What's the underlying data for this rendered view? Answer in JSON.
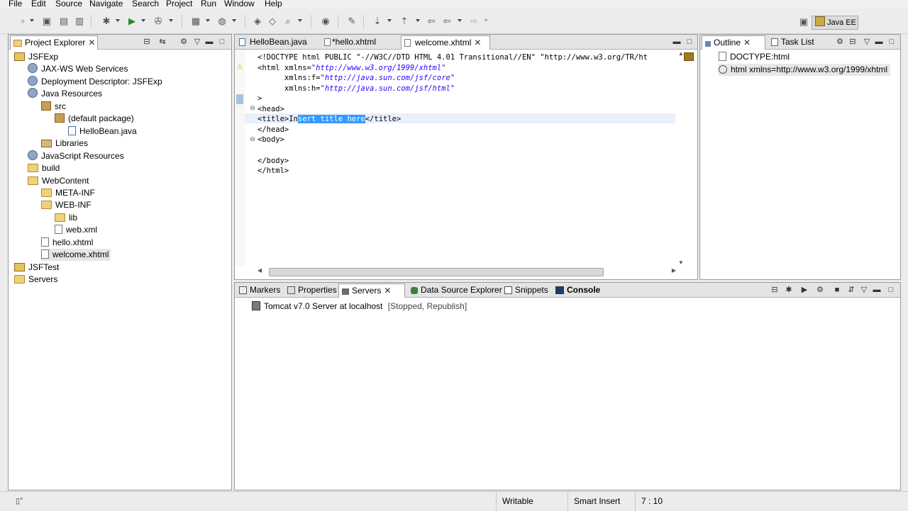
{
  "menu": [
    "File",
    "Edit",
    "Source",
    "Navigate",
    "Search",
    "Project",
    "Run",
    "Window",
    "Help"
  ],
  "perspective": "Java EE",
  "project_explorer": {
    "title": "Project Explorer",
    "items": [
      {
        "label": "JSFExp",
        "depth": 0,
        "icon": "project-icon"
      },
      {
        "label": "JAX-WS Web Services",
        "depth": 1,
        "icon": "webservices-icon"
      },
      {
        "label": "Deployment Descriptor: JSFExp",
        "depth": 1,
        "icon": "descriptor-icon"
      },
      {
        "label": "Java Resources",
        "depth": 1,
        "icon": "java-resources-icon"
      },
      {
        "label": "src",
        "depth": 2,
        "icon": "package-folder-icon"
      },
      {
        "label": "(default package)",
        "depth": 3,
        "icon": "package-icon"
      },
      {
        "label": "HelloBean.java",
        "depth": 4,
        "icon": "java-file-icon"
      },
      {
        "label": "Libraries",
        "depth": 2,
        "icon": "libraries-icon"
      },
      {
        "label": "JavaScript Resources",
        "depth": 1,
        "icon": "javascript-resources-icon"
      },
      {
        "label": "build",
        "depth": 1,
        "icon": "folder-icon"
      },
      {
        "label": "WebContent",
        "depth": 1,
        "icon": "folder-icon"
      },
      {
        "label": "META-INF",
        "depth": 2,
        "icon": "folder-icon"
      },
      {
        "label": "WEB-INF",
        "depth": 2,
        "icon": "folder-icon"
      },
      {
        "label": "lib",
        "depth": 3,
        "icon": "folder-icon"
      },
      {
        "label": "web.xml",
        "depth": 3,
        "icon": "xml-file-icon"
      },
      {
        "label": "hello.xhtml",
        "depth": 2,
        "icon": "xhtml-file-icon"
      },
      {
        "label": "welcome.xhtml",
        "depth": 2,
        "icon": "xhtml-file-icon",
        "selected": true
      },
      {
        "label": "JSFTest",
        "depth": 0,
        "icon": "project-icon"
      },
      {
        "label": "Servers",
        "depth": 0,
        "icon": "folder-icon"
      }
    ]
  },
  "editor": {
    "tabs": [
      {
        "label": "HelloBean.java",
        "active": false
      },
      {
        "label": "*hello.xhtml",
        "active": false
      },
      {
        "label": "welcome.xhtml",
        "active": true
      }
    ],
    "lines": [
      {
        "pre": "<!DOCTYPE html PUBLIC \"-//W3C//DTD HTML 4.01 Transitional//EN\" \"http://www.w3.org/TR/ht",
        "str": "",
        "post": ""
      },
      {
        "pre": "<html xmlns=",
        "str": "\"http://www.w3.org/1999/xhtml\"",
        "post": ""
      },
      {
        "pre": "      xmlns:f=",
        "str": "\"http://java.sun.com/jsf/core\"",
        "post": ""
      },
      {
        "pre": "      xmlns:h=",
        "str": "\"http://java.sun.com/jsf/html\"",
        "post": ""
      },
      {
        "pre": ">",
        "str": "",
        "post": ""
      },
      {
        "pre": "<head>",
        "str": "",
        "post": ""
      },
      {
        "pre": "<title>In",
        "str": "",
        "post": "</title>",
        "sel": "sert title here"
      },
      {
        "pre": "</head>",
        "str": "",
        "post": ""
      },
      {
        "pre": "<body>",
        "str": "",
        "post": ""
      },
      {
        "pre": "",
        "str": "",
        "post": ""
      },
      {
        "pre": "</body>",
        "str": "",
        "post": ""
      },
      {
        "pre": "</html>",
        "str": "",
        "post": ""
      }
    ]
  },
  "outline": {
    "tabs": [
      {
        "label": "Outline",
        "active": true
      },
      {
        "label": "Task List",
        "active": false
      }
    ],
    "items": [
      {
        "label": "DOCTYPE:html"
      },
      {
        "label": "html xmlns=http://www.w3.org/1999/xhtml"
      }
    ]
  },
  "bottom": {
    "tabs": [
      {
        "label": "Markers",
        "icon": "markers-icon"
      },
      {
        "label": "Properties",
        "icon": "properties-icon"
      },
      {
        "label": "Servers",
        "icon": "servers-icon",
        "active": true
      },
      {
        "label": "Data Source Explorer",
        "icon": "datasource-icon"
      },
      {
        "label": "Snippets",
        "icon": "snippets-icon"
      },
      {
        "label": "Console",
        "icon": "console-icon"
      }
    ],
    "server": {
      "name": "Tomcat v7.0 Server at localhost",
      "state": "[Stopped, Republish]"
    }
  },
  "status": {
    "writable": "Writable",
    "insert_mode": "Smart Insert",
    "position": "7 : 10"
  }
}
